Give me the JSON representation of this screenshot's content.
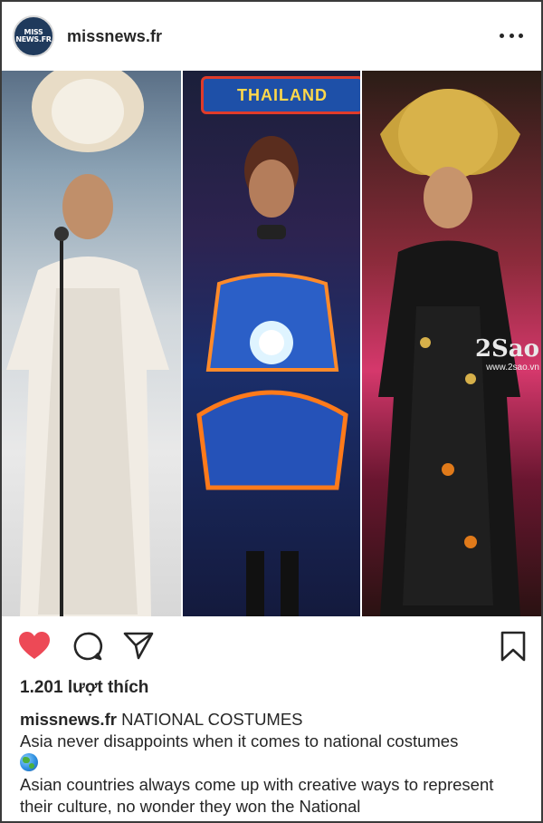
{
  "header": {
    "avatar_line1": "MISS",
    "avatar_line2": "NEWS.FR",
    "username": "missnews.fr",
    "more_icon": "more-horizontal-icon"
  },
  "photo": {
    "description_panels": [
      "panel-philippines",
      "panel-thailand",
      "panel-vietnam"
    ],
    "sign_text": "THAILAND",
    "watermark_top": "2Sao",
    "watermark_bottom": "www.2sao.vn"
  },
  "actions": {
    "like_icon": "heart-filled-icon",
    "comment_icon": "comment-icon",
    "share_icon": "send-icon",
    "save_icon": "bookmark-icon",
    "like_color": "#ed4956"
  },
  "likes": "1.201 lượt thích",
  "caption": {
    "username": "missnews.fr",
    "title": "NATIONAL COSTUMES",
    "line1": "Asia never disappoints when it comes to national costumes",
    "line2": "Asian countries always come up with creative ways to represent their culture, no wonder they won the National"
  }
}
